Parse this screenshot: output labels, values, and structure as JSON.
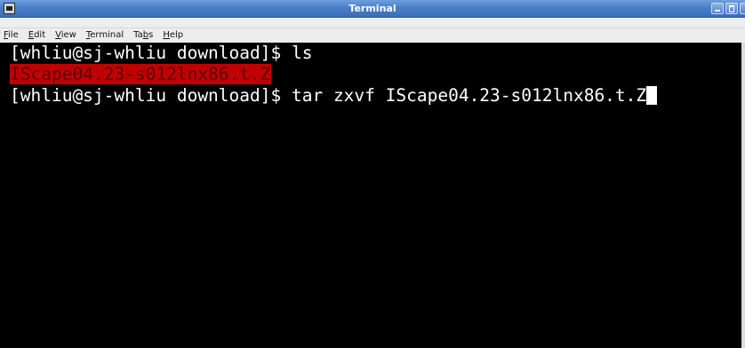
{
  "window": {
    "title": "Terminal"
  },
  "menu": {
    "items": [
      "File",
      "Edit",
      "View",
      "Terminal",
      "Tabs",
      "Help"
    ],
    "mnemonics": [
      "F",
      "E",
      "V",
      "T",
      "b",
      "H"
    ]
  },
  "terminal": {
    "lines": [
      {
        "prompt": "[whliu@sj-whliu download]$ ",
        "command": "ls"
      },
      {
        "output": "IScape04.23-s012lnx86.t.Z"
      },
      {
        "prompt": "[whliu@sj-whliu download]$ ",
        "command": "tar zxvf IScape04.23-s012lnx86.t.Z"
      }
    ]
  },
  "icons": {
    "window_icon": "terminal-window-icon",
    "minimize": "minimize-icon",
    "maximize": "maximize-icon",
    "close": "close-icon"
  },
  "colors": {
    "titlebar": "#4a7fc8",
    "terminal_bg": "#000000",
    "terminal_fg": "#ffffff",
    "highlight_bg": "#c00000",
    "highlight_fg": "#5a0000"
  }
}
